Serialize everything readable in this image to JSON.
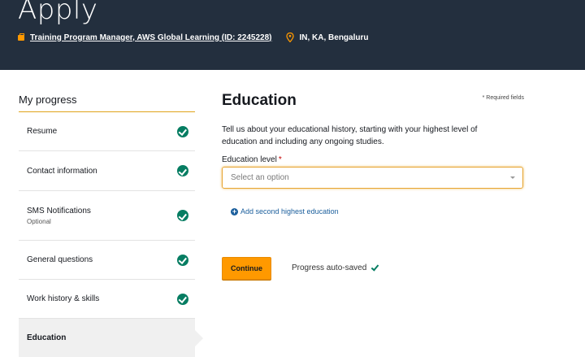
{
  "header": {
    "title": "Apply",
    "job_link": "Training Program Manager, AWS Global Learning (ID: 2245228)",
    "location": "IN, KA, Bengaluru"
  },
  "sidebar": {
    "title": "My progress",
    "steps": [
      {
        "label": "Resume",
        "sub": "",
        "completed": true
      },
      {
        "label": "Contact information",
        "sub": "",
        "completed": true
      },
      {
        "label": "SMS Notifications",
        "sub": "Optional",
        "completed": true
      },
      {
        "label": "General questions",
        "sub": "",
        "completed": true
      },
      {
        "label": "Work history & skills",
        "sub": "",
        "completed": true
      },
      {
        "label": "Education",
        "sub": "",
        "completed": false,
        "active": true
      }
    ]
  },
  "main": {
    "title": "Education",
    "required_note": "* Required fields",
    "intro": "Tell us about your educational history, starting with your highest level of education and including any ongoing studies.",
    "education_level": {
      "label": "Education level",
      "required_marker": "*",
      "placeholder": "Select an option",
      "value": ""
    },
    "add_link": "Add second highest education",
    "continue_label": "Continue",
    "autosave_text": "Progress auto-saved"
  },
  "colors": {
    "header_bg": "#232f3e",
    "accent": "#ff9900",
    "check_green": "#067d62",
    "link_blue": "#1a5e9c"
  }
}
